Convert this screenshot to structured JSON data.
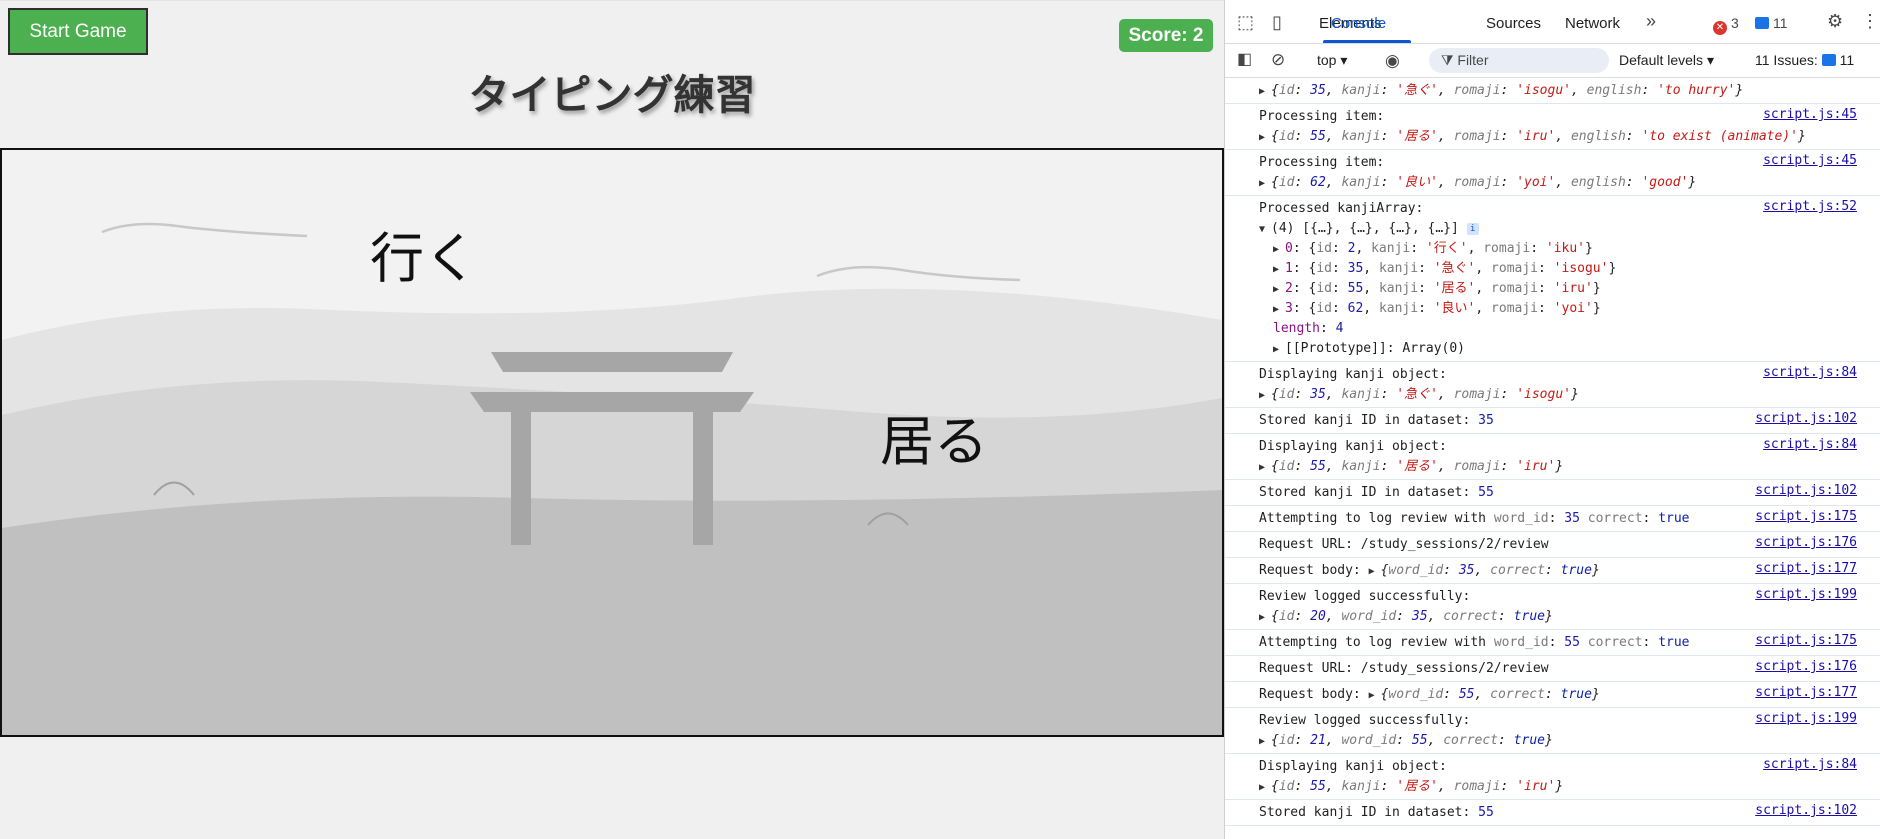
{
  "game": {
    "start_label": "Start Game",
    "score_label": "Score: 2",
    "title": "タイピング練習",
    "falling_words": [
      "行く",
      "居る"
    ]
  },
  "devtools": {
    "tabs": [
      "Elements",
      "Console",
      "Sources",
      "Network"
    ],
    "active_tab": "Console",
    "error_count": "3",
    "message_count": "11",
    "context": "top",
    "filter_placeholder": "Filter",
    "levels": "Default levels",
    "issues_label": "11 Issues:",
    "issues_count": "11"
  },
  "console": {
    "entries": [
      {
        "lines": [
          "▶ {id: 35, kanji: '急ぐ', romaji: 'isogu', english: 'to hurry'}"
        ],
        "source": ""
      },
      {
        "lines": [
          "Processing item:",
          "▶ {id: 55, kanji: '居る', romaji: 'iru', english: 'to exist (animate)'}"
        ],
        "source": "script.js:45"
      },
      {
        "lines": [
          "Processing item:",
          "▶ {id: 62, kanji: '良い', romaji: 'yoi', english: 'good'}"
        ],
        "source": "script.js:45"
      },
      {
        "lines": [
          "Processed kanjiArray:",
          "▼ (4) [{…}, {…}, {…}, {…}]",
          "▶ 0: {id: 2, kanji: '行く', romaji: 'iku'}",
          "▶ 1: {id: 35, kanji: '急ぐ', romaji: 'isogu'}",
          "▶ 2: {id: 55, kanji: '居る', romaji: 'iru'}",
          "▶ 3: {id: 62, kanji: '良い', romaji: 'yoi'}",
          "length: 4",
          "▶ [[Prototype]]: Array(0)"
        ],
        "source": "script.js:52"
      },
      {
        "lines": [
          "Displaying kanji object:",
          "▶ {id: 35, kanji: '急ぐ', romaji: 'isogu'}"
        ],
        "source": "script.js:84"
      },
      {
        "lines": [
          "Stored kanji ID in dataset: 35"
        ],
        "source": "script.js:102"
      },
      {
        "lines": [
          "Displaying kanji object:",
          "▶ {id: 55, kanji: '居る', romaji: 'iru'}"
        ],
        "source": "script.js:84"
      },
      {
        "lines": [
          "Stored kanji ID in dataset: 55"
        ],
        "source": "script.js:102"
      },
      {
        "lines": [
          "Attempting to log review with word_id: 35 correct: true"
        ],
        "source": "script.js:175"
      },
      {
        "lines": [
          "Request URL: /study_sessions/2/review"
        ],
        "source": "script.js:176"
      },
      {
        "lines": [
          "Request body: ▶ {word_id: 35, correct: true}"
        ],
        "source": "script.js:177"
      },
      {
        "lines": [
          "Review logged successfully:",
          "▶ {id: 20, word_id: 35, correct: true}"
        ],
        "source": "script.js:199"
      },
      {
        "lines": [
          "Attempting to log review with word_id: 55 correct: true"
        ],
        "source": "script.js:175"
      },
      {
        "lines": [
          "Request URL: /study_sessions/2/review"
        ],
        "source": "script.js:176"
      },
      {
        "lines": [
          "Request body: ▶ {word_id: 55, correct: true}"
        ],
        "source": "script.js:177"
      },
      {
        "lines": [
          "Review logged successfully:",
          "▶ {id: 21, word_id: 55, correct: true}"
        ],
        "source": "script.js:199"
      },
      {
        "lines": [
          "Displaying kanji object:",
          "▶ {id: 55, kanji: '居る', romaji: 'iru'}"
        ],
        "source": "script.js:84"
      },
      {
        "lines": [
          "Stored kanji ID in dataset: 55"
        ],
        "source": "script.js:102"
      }
    ]
  },
  "colors": {
    "accent_green": "#4caf50",
    "devtools_blue": "#0b57d0",
    "string_red": "#c41a16"
  }
}
